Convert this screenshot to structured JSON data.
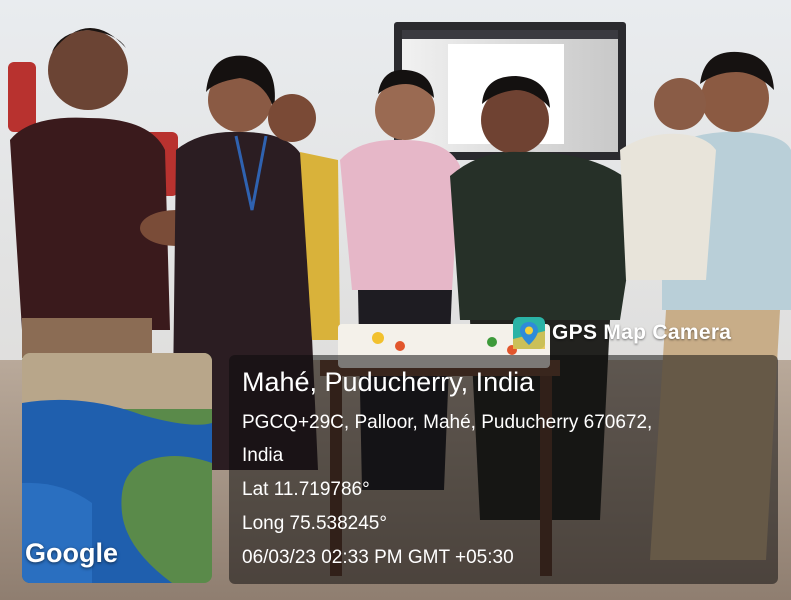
{
  "overlay": {
    "app_name": "GPS Map Camera",
    "app_icon": "map-pin-icon",
    "location_title": "Mahé, Puducherry, India",
    "address_line_1": "PGCQ+29C, Palloor, Mahé, Puducherry 670672,",
    "address_line_2": "India",
    "latitude": "Lat 11.719786°",
    "longitude": "Long 75.538245°",
    "datetime": "06/03/23 02:33 PM GMT +05:30"
  },
  "map": {
    "provider": "Google"
  },
  "colors": {
    "overlay_background": "#0c0c0c",
    "overlay_text": "#ffffff",
    "map_sea": "#1f5fae",
    "map_land": "#5a8a4a",
    "app_icon_teal": "#2bb3a6"
  }
}
